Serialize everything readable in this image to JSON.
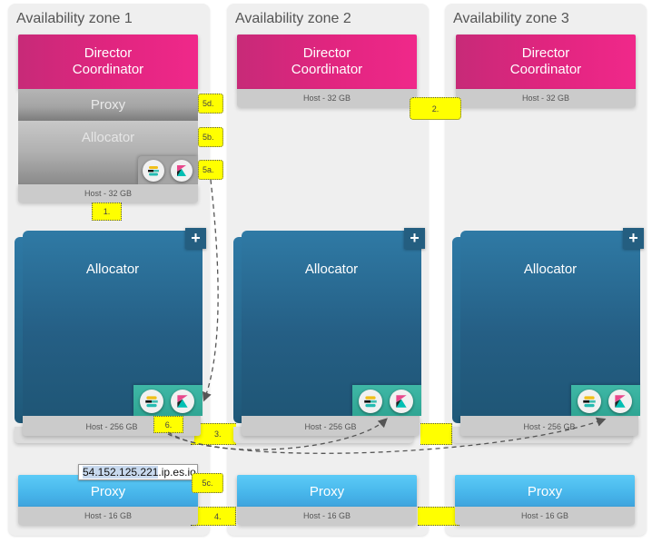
{
  "zones": [
    {
      "title": "Availability zone 1",
      "director": {
        "line1": "Director",
        "line2": "Coordinator",
        "host": "Host - 32 GB"
      },
      "small_host_roles": {
        "proxy": "Proxy",
        "allocator": "Allocator"
      },
      "allocator": {
        "label": "Allocator",
        "host": "Host - 256 GB",
        "add_icon": "+"
      },
      "proxy": {
        "label": "Proxy",
        "host": "Host - 16 GB"
      }
    },
    {
      "title": "Availability zone 2",
      "director": {
        "line1": "Director",
        "line2": "Coordinator",
        "host": "Host - 32 GB"
      },
      "allocator": {
        "label": "Allocator",
        "host": "Host - 256 GB",
        "add_icon": "+"
      },
      "proxy": {
        "label": "Proxy",
        "host": "Host - 16 GB"
      }
    },
    {
      "title": "Availability zone 3",
      "director": {
        "line1": "Director",
        "line2": "Coordinator",
        "host": "Host - 32 GB"
      },
      "allocator": {
        "label": "Allocator",
        "host": "Host - 256 GB",
        "add_icon": "+"
      },
      "proxy": {
        "label": "Proxy",
        "host": "Host - 16 GB"
      }
    }
  ],
  "instance_icons": [
    "elasticsearch-icon",
    "kibana-icon"
  ],
  "callouts": {
    "c1": "1.",
    "c2": "2.",
    "c3": "3.",
    "c4": "4.",
    "c5a": "5a.",
    "c5b": "5b.",
    "c5c": "5c.",
    "c5d": "5d.",
    "c6": "6."
  },
  "endpoint": {
    "ip": "54.152.125.221",
    "suffix": ".ip.es.io"
  },
  "colors": {
    "director": "#e0257f",
    "allocator": "#2a6a93",
    "proxy": "#4ab8ec",
    "callout": "#ffff00",
    "instance_tray": "#36ad9b"
  }
}
